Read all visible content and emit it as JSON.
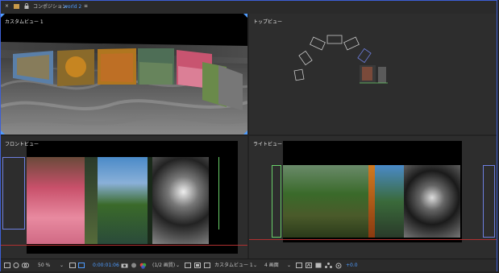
{
  "tabbar": {
    "close_glyph": "×",
    "composition_label": "コンポジション",
    "composition_name": "world 2",
    "menu_glyph": "≡"
  },
  "panes": {
    "custom": {
      "label": "カスタムビュー 1"
    },
    "top": {
      "label": "トップビュー"
    },
    "front": {
      "label": "フロントビュー"
    },
    "right": {
      "label": "ライトビュー"
    }
  },
  "statusbar": {
    "zoom": "50 %",
    "timecode": "0:00:01:06",
    "resolution": "(1/2 画質)",
    "active_camera": "カスタムビュー 1",
    "views": "4 画面",
    "exposure": "+0.0"
  },
  "colors": {
    "accent": "#4f9cff",
    "frame_border": "#3d5fd6",
    "ground_line": "#b03030",
    "layer_outline": "#6ad06a"
  }
}
